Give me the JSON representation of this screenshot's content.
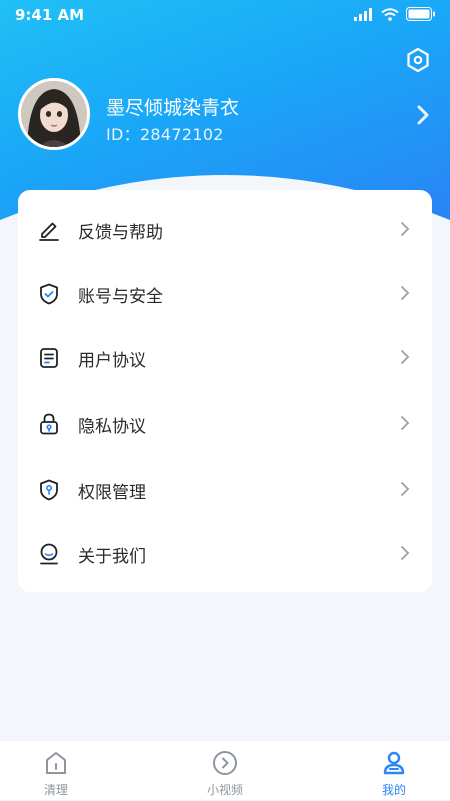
{
  "status_bar": {
    "time": "9:41 AM"
  },
  "profile": {
    "name": "墨尽倾城染青衣",
    "id_text": "ID：28472102"
  },
  "menu": [
    {
      "label": "反馈与帮助",
      "icon": "edit-icon"
    },
    {
      "label": "账号与安全",
      "icon": "shield-check-icon"
    },
    {
      "label": "用户协议",
      "icon": "document-icon"
    },
    {
      "label": "隐私协议",
      "icon": "lock-icon"
    },
    {
      "label": "权限管理",
      "icon": "shield-key-icon"
    },
    {
      "label": "关于我们",
      "icon": "about-icon"
    }
  ],
  "tabs": [
    {
      "label": "清理",
      "icon": "clean-icon",
      "active": false
    },
    {
      "label": "小视频",
      "icon": "video-icon",
      "active": false
    },
    {
      "label": "我的",
      "icon": "user-icon",
      "active": true
    }
  ],
  "colors": {
    "accent": "#2b86f6",
    "header_start": "#20c0f6",
    "header_end": "#2b80f5"
  }
}
